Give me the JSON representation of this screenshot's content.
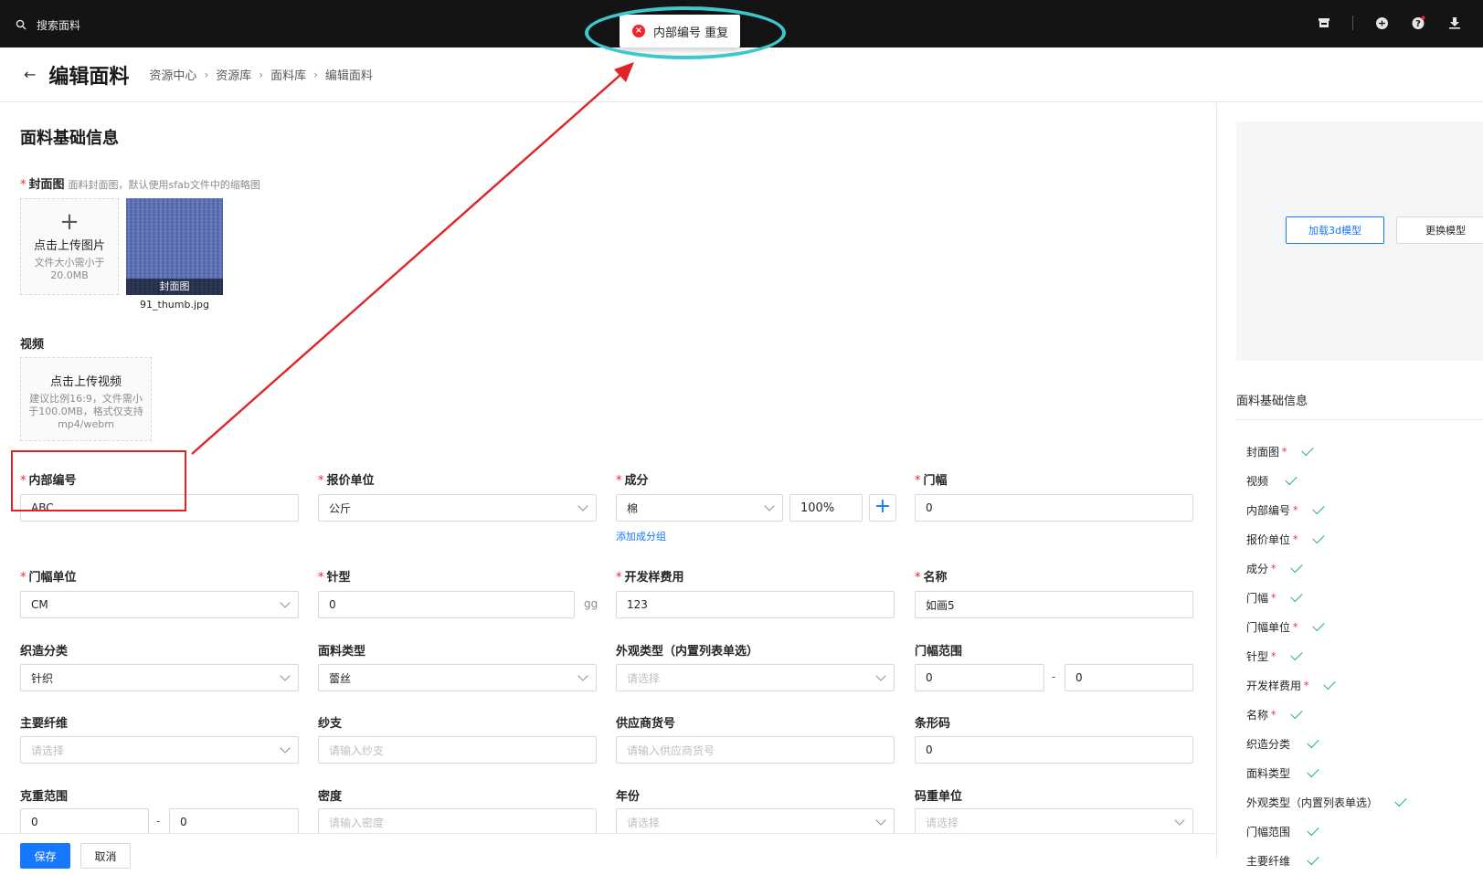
{
  "topbar": {
    "search_placeholder": "搜索面料"
  },
  "toast": {
    "message": "内部编号 重复"
  },
  "header": {
    "title": "编辑面料",
    "breadcrumbs": [
      "资源中心",
      "资源库",
      "面料库",
      "编辑面料"
    ]
  },
  "form": {
    "section_title": "面料基础信息",
    "cover": {
      "label": "封面图",
      "hint": "面料封面图，默认使用sfab文件中的缩略图",
      "upload_label": "点击上传图片",
      "upload_sub": "文件大小需小于20.0MB",
      "thumb_caption": "封面图",
      "file_name": "91_thumb.jpg"
    },
    "video": {
      "label": "视频",
      "upload_label": "点击上传视频",
      "upload_sub": "建议比例16:9，文件需小于100.0MB，格式仅支持mp4/webm"
    },
    "internal_code": {
      "label": "内部编号",
      "value": "ABC"
    },
    "quote_unit": {
      "label": "报价单位",
      "value": "公斤"
    },
    "composition": {
      "label": "成分",
      "value": "棉",
      "percent": "100%",
      "add_group": "添加成分组"
    },
    "width": {
      "label": "门幅",
      "value": "0"
    },
    "width_unit": {
      "label": "门幅单位",
      "value": "CM"
    },
    "needle_type": {
      "label": "针型",
      "value": "0",
      "unit": "gg"
    },
    "sample_fee": {
      "label": "开发样费用",
      "value": "123"
    },
    "name": {
      "label": "名称",
      "value": "如画5"
    },
    "weave_category": {
      "label": "织造分类",
      "value": "针织"
    },
    "fabric_type": {
      "label": "面料类型",
      "value": "蕾丝"
    },
    "appearance_type": {
      "label": "外观类型（内置列表单选）",
      "placeholder": "请选择"
    },
    "width_range": {
      "label": "门幅范围",
      "min": "0",
      "max": "0",
      "dash": "-"
    },
    "main_fiber": {
      "label": "主要纤维",
      "placeholder": "请选择"
    },
    "yarn_count": {
      "label": "纱支",
      "placeholder": "请输入纱支"
    },
    "supplier_code": {
      "label": "供应商货号",
      "placeholder": "请输入供应商货号"
    },
    "barcode": {
      "label": "条形码",
      "value": "0"
    },
    "gram_range": {
      "label": "克重范围",
      "min": "0",
      "max": "0",
      "dash": "-"
    },
    "density": {
      "label": "密度",
      "placeholder": "请输入密度"
    },
    "year": {
      "label": "年份",
      "placeholder": "请选择"
    },
    "yard_weight_unit": {
      "label": "码重单位",
      "placeholder": "请选择"
    }
  },
  "footer": {
    "save_label": "保存",
    "cancel_label": "取消"
  },
  "right_panel": {
    "load_model_label": "加载3d模型",
    "replace_model_label": "更换模型",
    "title": "面料基础信息",
    "checklist": [
      {
        "label": "封面图",
        "required": "*"
      },
      {
        "label": "视频",
        "required": ""
      },
      {
        "label": "内部编号",
        "required": "*"
      },
      {
        "label": "报价单位",
        "required": "*"
      },
      {
        "label": "成分",
        "required": "*"
      },
      {
        "label": "门幅",
        "required": "*"
      },
      {
        "label": "门幅单位",
        "required": "*"
      },
      {
        "label": "针型",
        "required": "*"
      },
      {
        "label": "开发样费用",
        "required": "*"
      },
      {
        "label": "名称",
        "required": "*"
      },
      {
        "label": "织造分类",
        "required": ""
      },
      {
        "label": "面料类型",
        "required": ""
      },
      {
        "label": "外观类型（内置列表单选）",
        "required": ""
      },
      {
        "label": "门幅范围",
        "required": ""
      },
      {
        "label": "主要纤维",
        "required": ""
      }
    ]
  },
  "colors": {
    "topbar": "#141414",
    "primary": "#1677ff",
    "required": "#f5222d",
    "check": "#2fb36a",
    "annotation_ring": "#3cc8cc",
    "annotation_box": "#e02424"
  }
}
